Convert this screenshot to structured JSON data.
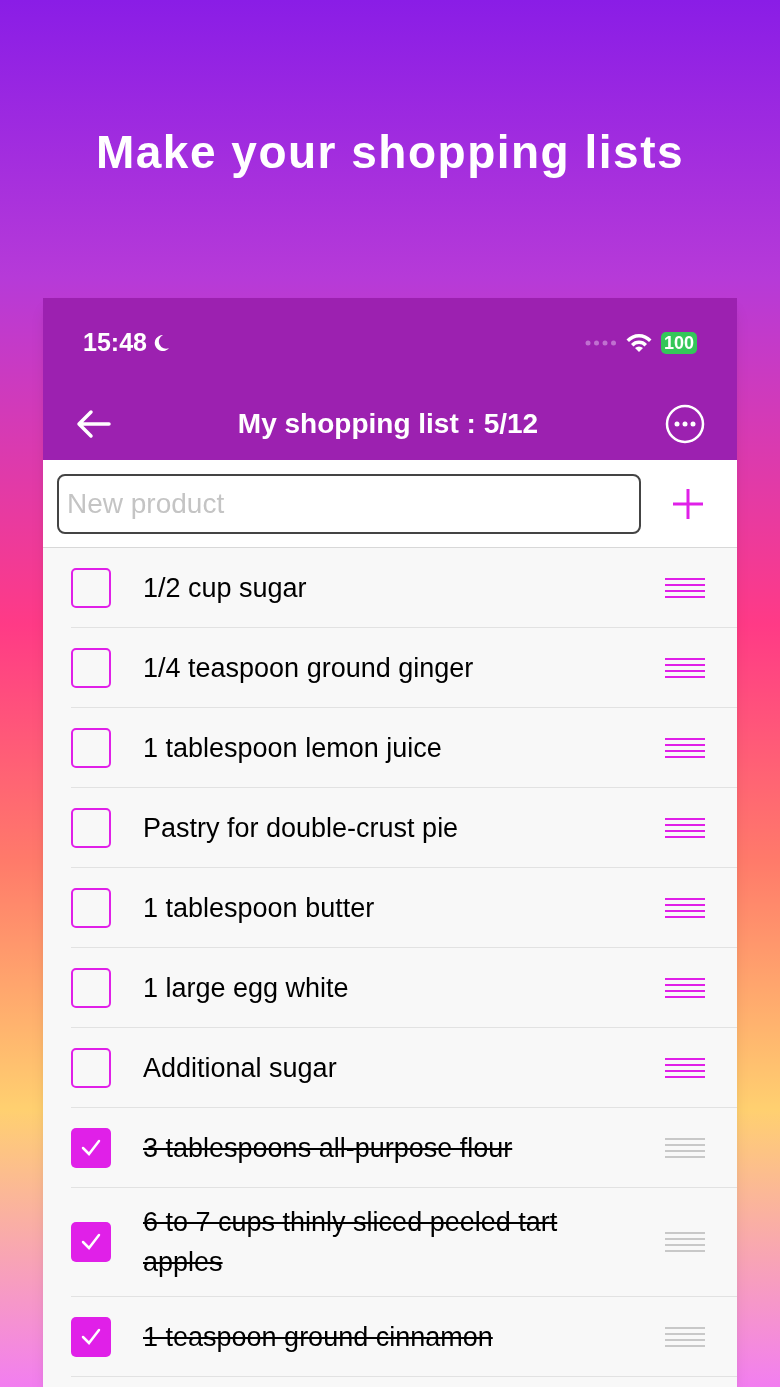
{
  "headline": "Make your shopping lists",
  "status_bar": {
    "time": "15:48",
    "battery": "100"
  },
  "header": {
    "title": "My shopping list : 5/12"
  },
  "new_product": {
    "placeholder": "New product"
  },
  "items": [
    {
      "label": "1/2 cup sugar",
      "checked": false
    },
    {
      "label": "1/4 teaspoon ground ginger",
      "checked": false
    },
    {
      "label": "1 tablespoon lemon juice",
      "checked": false
    },
    {
      "label": "Pastry for double-crust pie",
      "checked": false
    },
    {
      "label": "1 tablespoon butter",
      "checked": false
    },
    {
      "label": "1 large egg white",
      "checked": false
    },
    {
      "label": "Additional sugar",
      "checked": false
    },
    {
      "label": "3 tablespoons all-purpose flour",
      "checked": true
    },
    {
      "label": "6 to 7 cups thinly sliced peeled tart apples",
      "checked": true
    },
    {
      "label": "1 teaspoon ground cinnamon",
      "checked": true
    }
  ]
}
